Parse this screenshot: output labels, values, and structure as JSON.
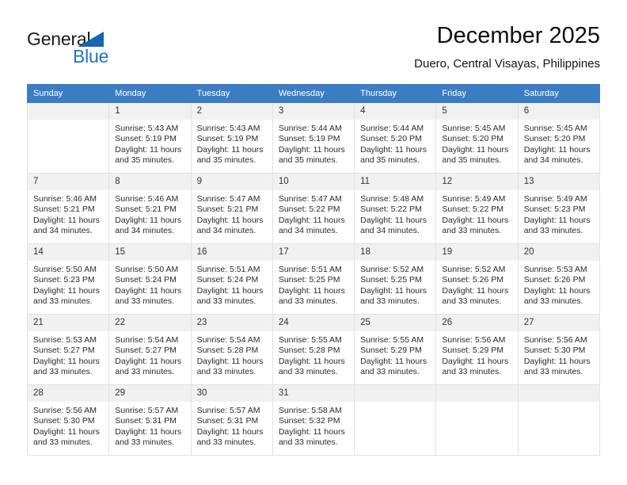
{
  "logo": {
    "word_primary": "General",
    "word_secondary": "Blue",
    "triangle_color": "#1565b0",
    "secondary_color": "#1f74c4"
  },
  "header": {
    "title": "December 2025",
    "subtitle": "Duero, Central Visayas, Philippines"
  },
  "theme": {
    "header_row_bg": "#3b7dc4",
    "day_number_bg": "#f1f1f1",
    "grid_border": "#e2e2e2"
  },
  "weekdays": [
    "Sunday",
    "Monday",
    "Tuesday",
    "Wednesday",
    "Thursday",
    "Friday",
    "Saturday"
  ],
  "labels": {
    "sunrise_prefix": "Sunrise:",
    "sunset_prefix": "Sunset:",
    "daylight_prefix": "Daylight:"
  },
  "weeks": [
    [
      {
        "day": "",
        "sunrise": "",
        "sunset": "",
        "daylight_line1": "",
        "daylight_line2": "",
        "empty": true
      },
      {
        "day": "1",
        "sunrise": "Sunrise: 5:43 AM",
        "sunset": "Sunset: 5:19 PM",
        "daylight_line1": "Daylight: 11 hours",
        "daylight_line2": "and 35 minutes."
      },
      {
        "day": "2",
        "sunrise": "Sunrise: 5:43 AM",
        "sunset": "Sunset: 5:19 PM",
        "daylight_line1": "Daylight: 11 hours",
        "daylight_line2": "and 35 minutes."
      },
      {
        "day": "3",
        "sunrise": "Sunrise: 5:44 AM",
        "sunset": "Sunset: 5:19 PM",
        "daylight_line1": "Daylight: 11 hours",
        "daylight_line2": "and 35 minutes."
      },
      {
        "day": "4",
        "sunrise": "Sunrise: 5:44 AM",
        "sunset": "Sunset: 5:20 PM",
        "daylight_line1": "Daylight: 11 hours",
        "daylight_line2": "and 35 minutes."
      },
      {
        "day": "5",
        "sunrise": "Sunrise: 5:45 AM",
        "sunset": "Sunset: 5:20 PM",
        "daylight_line1": "Daylight: 11 hours",
        "daylight_line2": "and 35 minutes."
      },
      {
        "day": "6",
        "sunrise": "Sunrise: 5:45 AM",
        "sunset": "Sunset: 5:20 PM",
        "daylight_line1": "Daylight: 11 hours",
        "daylight_line2": "and 34 minutes."
      }
    ],
    [
      {
        "day": "7",
        "sunrise": "Sunrise: 5:46 AM",
        "sunset": "Sunset: 5:21 PM",
        "daylight_line1": "Daylight: 11 hours",
        "daylight_line2": "and 34 minutes."
      },
      {
        "day": "8",
        "sunrise": "Sunrise: 5:46 AM",
        "sunset": "Sunset: 5:21 PM",
        "daylight_line1": "Daylight: 11 hours",
        "daylight_line2": "and 34 minutes."
      },
      {
        "day": "9",
        "sunrise": "Sunrise: 5:47 AM",
        "sunset": "Sunset: 5:21 PM",
        "daylight_line1": "Daylight: 11 hours",
        "daylight_line2": "and 34 minutes."
      },
      {
        "day": "10",
        "sunrise": "Sunrise: 5:47 AM",
        "sunset": "Sunset: 5:22 PM",
        "daylight_line1": "Daylight: 11 hours",
        "daylight_line2": "and 34 minutes."
      },
      {
        "day": "11",
        "sunrise": "Sunrise: 5:48 AM",
        "sunset": "Sunset: 5:22 PM",
        "daylight_line1": "Daylight: 11 hours",
        "daylight_line2": "and 34 minutes."
      },
      {
        "day": "12",
        "sunrise": "Sunrise: 5:49 AM",
        "sunset": "Sunset: 5:22 PM",
        "daylight_line1": "Daylight: 11 hours",
        "daylight_line2": "and 33 minutes."
      },
      {
        "day": "13",
        "sunrise": "Sunrise: 5:49 AM",
        "sunset": "Sunset: 5:23 PM",
        "daylight_line1": "Daylight: 11 hours",
        "daylight_line2": "and 33 minutes."
      }
    ],
    [
      {
        "day": "14",
        "sunrise": "Sunrise: 5:50 AM",
        "sunset": "Sunset: 5:23 PM",
        "daylight_line1": "Daylight: 11 hours",
        "daylight_line2": "and 33 minutes."
      },
      {
        "day": "15",
        "sunrise": "Sunrise: 5:50 AM",
        "sunset": "Sunset: 5:24 PM",
        "daylight_line1": "Daylight: 11 hours",
        "daylight_line2": "and 33 minutes."
      },
      {
        "day": "16",
        "sunrise": "Sunrise: 5:51 AM",
        "sunset": "Sunset: 5:24 PM",
        "daylight_line1": "Daylight: 11 hours",
        "daylight_line2": "and 33 minutes."
      },
      {
        "day": "17",
        "sunrise": "Sunrise: 5:51 AM",
        "sunset": "Sunset: 5:25 PM",
        "daylight_line1": "Daylight: 11 hours",
        "daylight_line2": "and 33 minutes."
      },
      {
        "day": "18",
        "sunrise": "Sunrise: 5:52 AM",
        "sunset": "Sunset: 5:25 PM",
        "daylight_line1": "Daylight: 11 hours",
        "daylight_line2": "and 33 minutes."
      },
      {
        "day": "19",
        "sunrise": "Sunrise: 5:52 AM",
        "sunset": "Sunset: 5:26 PM",
        "daylight_line1": "Daylight: 11 hours",
        "daylight_line2": "and 33 minutes."
      },
      {
        "day": "20",
        "sunrise": "Sunrise: 5:53 AM",
        "sunset": "Sunset: 5:26 PM",
        "daylight_line1": "Daylight: 11 hours",
        "daylight_line2": "and 33 minutes."
      }
    ],
    [
      {
        "day": "21",
        "sunrise": "Sunrise: 5:53 AM",
        "sunset": "Sunset: 5:27 PM",
        "daylight_line1": "Daylight: 11 hours",
        "daylight_line2": "and 33 minutes."
      },
      {
        "day": "22",
        "sunrise": "Sunrise: 5:54 AM",
        "sunset": "Sunset: 5:27 PM",
        "daylight_line1": "Daylight: 11 hours",
        "daylight_line2": "and 33 minutes."
      },
      {
        "day": "23",
        "sunrise": "Sunrise: 5:54 AM",
        "sunset": "Sunset: 5:28 PM",
        "daylight_line1": "Daylight: 11 hours",
        "daylight_line2": "and 33 minutes."
      },
      {
        "day": "24",
        "sunrise": "Sunrise: 5:55 AM",
        "sunset": "Sunset: 5:28 PM",
        "daylight_line1": "Daylight: 11 hours",
        "daylight_line2": "and 33 minutes."
      },
      {
        "day": "25",
        "sunrise": "Sunrise: 5:55 AM",
        "sunset": "Sunset: 5:29 PM",
        "daylight_line1": "Daylight: 11 hours",
        "daylight_line2": "and 33 minutes."
      },
      {
        "day": "26",
        "sunrise": "Sunrise: 5:56 AM",
        "sunset": "Sunset: 5:29 PM",
        "daylight_line1": "Daylight: 11 hours",
        "daylight_line2": "and 33 minutes."
      },
      {
        "day": "27",
        "sunrise": "Sunrise: 5:56 AM",
        "sunset": "Sunset: 5:30 PM",
        "daylight_line1": "Daylight: 11 hours",
        "daylight_line2": "and 33 minutes."
      }
    ],
    [
      {
        "day": "28",
        "sunrise": "Sunrise: 5:56 AM",
        "sunset": "Sunset: 5:30 PM",
        "daylight_line1": "Daylight: 11 hours",
        "daylight_line2": "and 33 minutes."
      },
      {
        "day": "29",
        "sunrise": "Sunrise: 5:57 AM",
        "sunset": "Sunset: 5:31 PM",
        "daylight_line1": "Daylight: 11 hours",
        "daylight_line2": "and 33 minutes."
      },
      {
        "day": "30",
        "sunrise": "Sunrise: 5:57 AM",
        "sunset": "Sunset: 5:31 PM",
        "daylight_line1": "Daylight: 11 hours",
        "daylight_line2": "and 33 minutes."
      },
      {
        "day": "31",
        "sunrise": "Sunrise: 5:58 AM",
        "sunset": "Sunset: 5:32 PM",
        "daylight_line1": "Daylight: 11 hours",
        "daylight_line2": "and 33 minutes."
      },
      {
        "day": "",
        "sunrise": "",
        "sunset": "",
        "daylight_line1": "",
        "daylight_line2": "",
        "empty": true
      },
      {
        "day": "",
        "sunrise": "",
        "sunset": "",
        "daylight_line1": "",
        "daylight_line2": "",
        "empty": true
      },
      {
        "day": "",
        "sunrise": "",
        "sunset": "",
        "daylight_line1": "",
        "daylight_line2": "",
        "empty": true
      }
    ]
  ]
}
